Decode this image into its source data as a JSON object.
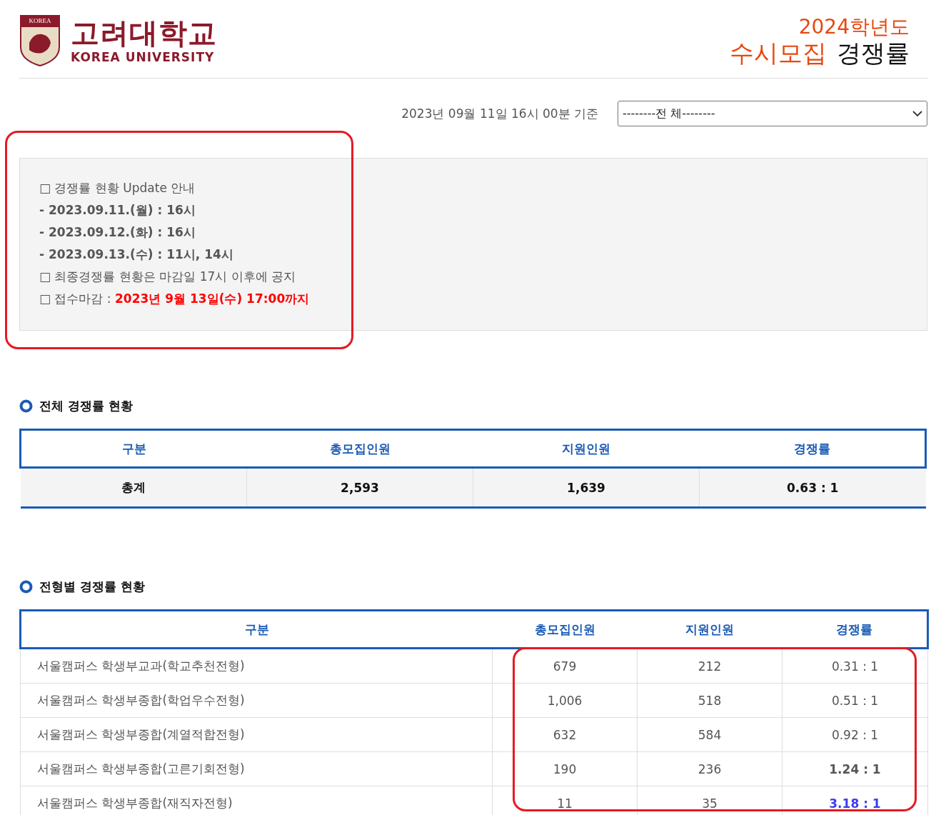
{
  "header": {
    "logo": {
      "emblem_text": "KOREA",
      "name_ko": "고려대학교",
      "name_en": "KOREA UNIVERSITY"
    },
    "year": "2024학년도",
    "title_accent": "수시모집",
    "title": "경쟁률"
  },
  "filter": {
    "timestamp": "2023년 09월 11일 16시 00분 기준",
    "select_value": "--------전 체--------"
  },
  "notice": {
    "highlighted": true,
    "lines": [
      {
        "kind": "plain",
        "text": "□ 경쟁률 현황 Update 안내"
      },
      {
        "kind": "bold",
        "text": "- 2023.09.11.(월) : 16시"
      },
      {
        "kind": "bold",
        "text": "- 2023.09.12.(화) : 16시"
      },
      {
        "kind": "bold",
        "text": "- 2023.09.13.(수) : 11시, 14시"
      },
      {
        "kind": "plain",
        "text": "□ 최종경쟁률 현황은 마감일 17시 이후에 공지"
      },
      {
        "kind": "deadline",
        "text": "□ 접수마감 : **2023년 9월 13일(수) 17:00까지**"
      }
    ]
  },
  "overall": {
    "title": "전체 경쟁률 현황",
    "columns": [
      "구분",
      "총모집인원",
      "지원인원",
      "경쟁률"
    ],
    "rows": [
      {
        "cells": [
          "총계",
          "2,593",
          "1,639",
          "0.63 : 1"
        ]
      }
    ]
  },
  "by_type": {
    "title": "전형별 경쟁률 현황",
    "values_highlighted": true,
    "columns": [
      "구분",
      "총모집인원",
      "지원인원",
      "경쟁률"
    ],
    "rows": [
      {
        "cells": [
          "서울캠퍼스 학생부교과(학교추천전형)",
          "679",
          "212",
          "0.31 : 1"
        ],
        "strong": false,
        "color": "#555555"
      },
      {
        "cells": [
          "서울캠퍼스 학생부종합(학업우수전형)",
          "1,006",
          "518",
          "0.51 : 1"
        ],
        "strong": false,
        "color": "#555555"
      },
      {
        "cells": [
          "서울캠퍼스 학생부종합(계열적합전형)",
          "632",
          "584",
          "0.92 : 1"
        ],
        "strong": false,
        "color": "#555555"
      },
      {
        "cells": [
          "서울캠퍼스 학생부종합(고른기회전형)",
          "190",
          "236",
          "1.24 : 1"
        ],
        "strong": true,
        "color": "#555555"
      },
      {
        "cells": [
          "서울캠퍼스 학생부종합(재직자전형)",
          "11",
          "35",
          "3.18 : 1"
        ],
        "strong": true,
        "color": "#3b3bf5"
      }
    ]
  }
}
